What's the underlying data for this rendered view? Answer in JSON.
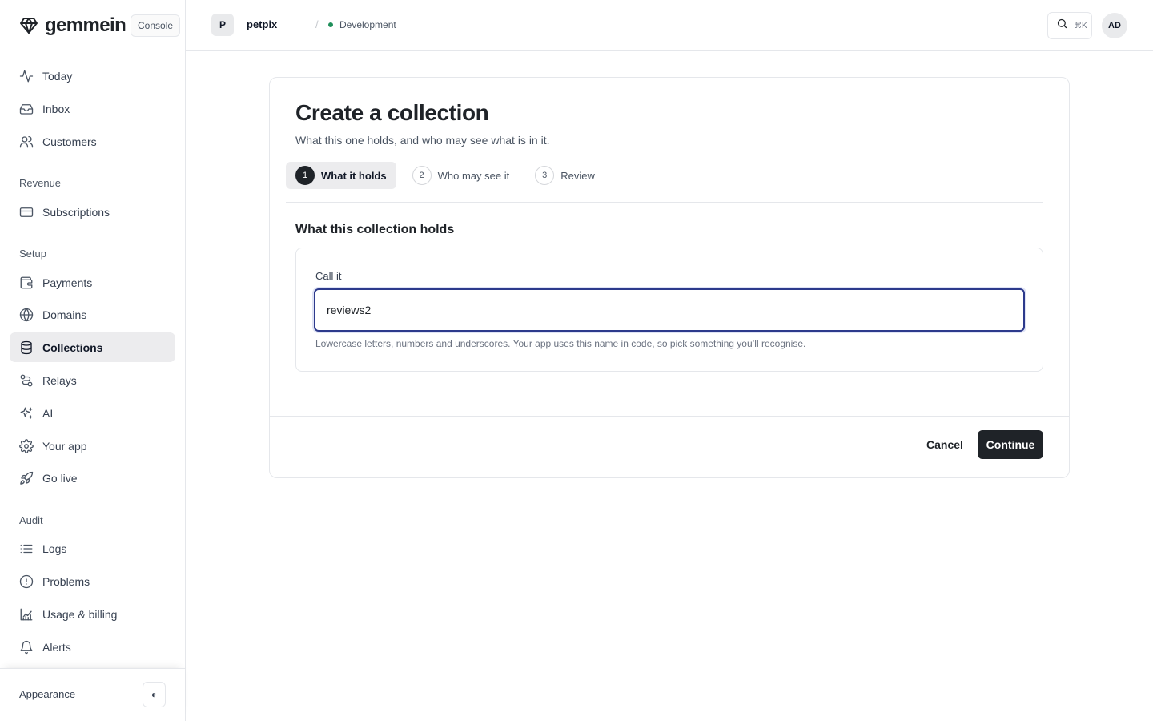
{
  "brand": {
    "name": "gemmein",
    "badge": "Console",
    "icon": "gem-icon"
  },
  "sidebar": {
    "items": [
      {
        "label": "Today",
        "icon": "activity-icon"
      },
      {
        "label": "Inbox",
        "icon": "inbox-icon"
      },
      {
        "label": "Customers",
        "icon": "users-icon"
      },
      {
        "label": "Subscriptions",
        "icon": "credit-card-icon"
      },
      {
        "label": "Payments",
        "icon": "wallet-icon"
      },
      {
        "label": "Domains",
        "icon": "globe-icon"
      },
      {
        "label": "Collections",
        "icon": "database-icon",
        "active": true
      },
      {
        "label": "Relays",
        "icon": "route-icon"
      },
      {
        "label": "AI",
        "icon": "sparkles-icon"
      },
      {
        "label": "Your app",
        "icon": "gear-icon"
      },
      {
        "label": "Go live",
        "icon": "rocket-icon"
      },
      {
        "label": "Logs",
        "icon": "list-icon"
      },
      {
        "label": "Problems",
        "icon": "alert-circle-icon"
      },
      {
        "label": "Usage & billing",
        "icon": "chart-icon"
      },
      {
        "label": "Alerts",
        "icon": "bell-icon"
      }
    ],
    "sections": {
      "revenue": "Revenue",
      "setup": "Setup",
      "audit": "Audit"
    },
    "footer": {
      "appearance_label": "Appearance",
      "toggle_glyph": "◐"
    }
  },
  "topbar": {
    "project_initial": "P",
    "project_name": "petpix",
    "separator": "/",
    "environment": "Development",
    "environment_color": "#1f8f5a",
    "search_shortcut": "⌘K",
    "user_initials": "AD"
  },
  "wizard": {
    "title": "Create a collection",
    "subtitle": "What this one holds, and who may see what is in it.",
    "steps": [
      {
        "num": "1",
        "label": "What it holds",
        "active": true
      },
      {
        "num": "2",
        "label": "Who may see it",
        "active": false
      },
      {
        "num": "3",
        "label": "Review",
        "active": false
      }
    ],
    "section_title": "What this collection holds",
    "field": {
      "label": "Call it",
      "value": "reviews2",
      "help": "Lowercase letters, numbers and underscores. Your app uses this name in code, so pick something you’ll recognise."
    },
    "cancel_label": "Cancel",
    "continue_label": "Continue"
  },
  "colors": {
    "primary_button": "#1f2328",
    "focus_ring": "#2d3a8c"
  }
}
